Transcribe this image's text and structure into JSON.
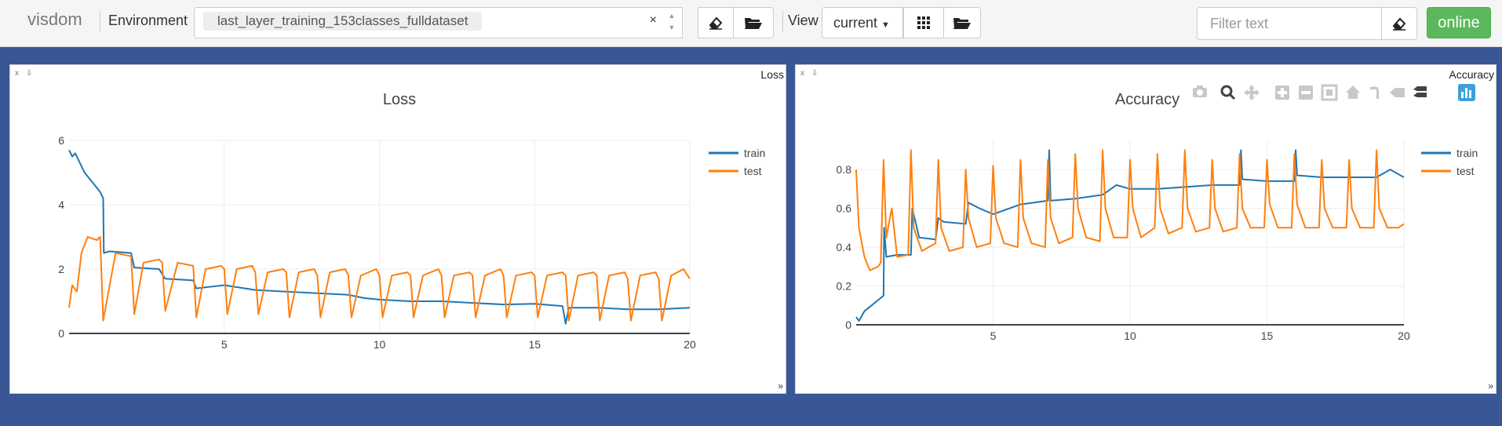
{
  "topbar": {
    "brand": "visdom",
    "environment_label": "Environment",
    "environment_value": "last_layer_training_153classes_fulldataset",
    "clear_symbol": "×",
    "view_label": "View",
    "view_select": "current",
    "filter_placeholder": "Filter text",
    "online_label": "online"
  },
  "panes": {
    "loss": {
      "window_title": "Loss",
      "close_label": "x",
      "download_label": "⇩",
      "resize_label": "»"
    },
    "accuracy": {
      "window_title": "Accuracy",
      "close_label": "x",
      "download_label": "⇩",
      "resize_label": "»"
    }
  },
  "icons": [
    "eraser-icon",
    "folder-open-icon",
    "grid-icon",
    "camera-icon",
    "zoom-icon",
    "pan-icon",
    "zoom-in-icon",
    "zoom-out-icon",
    "autoscale-icon",
    "home-icon",
    "spike-lines-icon",
    "hover-closest-icon",
    "hover-compare-icon",
    "plotly-logo-icon"
  ],
  "colors": {
    "train": "#1f77b4",
    "test": "#ff7f0e",
    "background": "#3a5795",
    "online": "#5cb85c"
  },
  "chart_data": [
    {
      "type": "line",
      "title": "Loss",
      "xlim": [
        0,
        20
      ],
      "ylim": [
        0,
        6
      ],
      "xticks": [
        5,
        10,
        15,
        20
      ],
      "yticks": [
        0,
        2,
        4,
        6
      ],
      "grid": true,
      "legend": "top-right",
      "series": [
        {
          "name": "train",
          "x": [
            0,
            0.1,
            0.2,
            0.5,
            1.0,
            1.1,
            1.12,
            1.3,
            2.0,
            2.1,
            2.9,
            3.1,
            4.0,
            4.1,
            5.0,
            6.0,
            7.0,
            8.0,
            9.0,
            9.5,
            10.0,
            11.0,
            12.0,
            13.0,
            14.0,
            15.0,
            15.9,
            16.0,
            16.1,
            17.0,
            18.0,
            19.0,
            20.0
          ],
          "values": [
            5.7,
            5.5,
            5.6,
            5.0,
            4.4,
            4.2,
            2.5,
            2.55,
            2.5,
            2.05,
            2.0,
            1.7,
            1.65,
            1.4,
            1.5,
            1.35,
            1.3,
            1.25,
            1.2,
            1.1,
            1.05,
            1.0,
            1.0,
            0.95,
            0.9,
            0.92,
            0.85,
            0.3,
            0.8,
            0.8,
            0.75,
            0.75,
            0.8
          ]
        },
        {
          "name": "test",
          "x": [
            0,
            0.1,
            0.25,
            0.4,
            0.6,
            0.9,
            1.0,
            1.1,
            1.5,
            2.0,
            2.1,
            2.4,
            2.9,
            3.0,
            3.1,
            3.5,
            4.0,
            4.1,
            4.4,
            4.9,
            5.0,
            5.1,
            5.4,
            5.9,
            6.0,
            6.1,
            6.4,
            6.9,
            7.0,
            7.1,
            7.4,
            7.9,
            8.0,
            8.1,
            8.4,
            8.9,
            9.0,
            9.1,
            9.4,
            9.9,
            10.0,
            10.1,
            10.4,
            10.9,
            11.0,
            11.1,
            11.4,
            11.9,
            12.0,
            12.1,
            12.4,
            12.9,
            13.0,
            13.1,
            13.4,
            13.9,
            14.0,
            14.1,
            14.4,
            14.9,
            15.0,
            15.1,
            15.4,
            15.9,
            16.0,
            16.1,
            16.4,
            16.9,
            17.0,
            17.1,
            17.4,
            17.9,
            18.0,
            18.1,
            18.4,
            18.9,
            19.0,
            19.1,
            19.4,
            19.8,
            20.0
          ],
          "values": [
            0.8,
            1.5,
            1.3,
            2.5,
            3.0,
            2.9,
            3.0,
            0.4,
            2.5,
            2.4,
            0.6,
            2.2,
            2.3,
            2.2,
            0.7,
            2.2,
            2.1,
            0.5,
            2.0,
            2.1,
            2.0,
            0.6,
            2.0,
            2.1,
            1.9,
            0.6,
            1.9,
            2.0,
            1.9,
            0.5,
            1.9,
            2.0,
            1.8,
            0.5,
            1.9,
            2.0,
            1.8,
            0.5,
            1.8,
            2.0,
            1.8,
            0.5,
            1.8,
            1.9,
            1.8,
            0.5,
            1.8,
            2.0,
            1.8,
            0.5,
            1.8,
            1.9,
            1.8,
            0.5,
            1.8,
            2.0,
            1.8,
            0.5,
            1.8,
            1.9,
            1.8,
            0.5,
            1.8,
            1.9,
            1.8,
            0.4,
            1.8,
            1.9,
            1.8,
            0.4,
            1.8,
            1.9,
            1.7,
            0.4,
            1.8,
            1.9,
            1.7,
            0.4,
            1.8,
            2.0,
            1.7
          ]
        }
      ]
    },
    {
      "type": "line",
      "title": "Accuracy",
      "xlim": [
        0,
        20
      ],
      "ylim": [
        0,
        0.95
      ],
      "xticks": [
        5,
        10,
        15,
        20
      ],
      "yticks": [
        0,
        0.2,
        0.4,
        0.6,
        0.8
      ],
      "grid": true,
      "legend": "top-right",
      "series": [
        {
          "name": "train",
          "x": [
            0,
            0.1,
            0.3,
            1.0,
            1.02,
            1.1,
            1.5,
            2.0,
            2.05,
            2.3,
            2.9,
            3.0,
            3.2,
            4.0,
            4.1,
            4.5,
            5.0,
            6.0,
            7.0,
            7.05,
            7.1,
            8.0,
            9.0,
            9.5,
            10.0,
            11.0,
            12.0,
            13.0,
            14.0,
            14.05,
            14.1,
            15.0,
            16.0,
            16.05,
            16.1,
            17.0,
            18.0,
            19.0,
            19.5,
            20.0
          ],
          "values": [
            0.04,
            0.02,
            0.07,
            0.15,
            0.5,
            0.35,
            0.36,
            0.36,
            0.6,
            0.45,
            0.44,
            0.55,
            0.53,
            0.52,
            0.63,
            0.6,
            0.57,
            0.62,
            0.64,
            0.9,
            0.64,
            0.65,
            0.67,
            0.72,
            0.7,
            0.7,
            0.71,
            0.72,
            0.72,
            0.9,
            0.75,
            0.74,
            0.74,
            0.9,
            0.77,
            0.76,
            0.76,
            0.76,
            0.8,
            0.76
          ]
        },
        {
          "name": "test",
          "x": [
            0,
            0.1,
            0.3,
            0.5,
            0.8,
            0.9,
            1.0,
            1.1,
            1.3,
            1.5,
            1.9,
            2.0,
            2.1,
            2.4,
            2.9,
            3.0,
            3.1,
            3.4,
            3.9,
            4.0,
            4.1,
            4.4,
            4.9,
            5.0,
            5.1,
            5.4,
            5.9,
            6.0,
            6.1,
            6.4,
            6.9,
            7.0,
            7.1,
            7.4,
            7.9,
            8.0,
            8.1,
            8.4,
            8.9,
            9.0,
            9.1,
            9.4,
            9.9,
            10.0,
            10.1,
            10.4,
            10.9,
            11.0,
            11.1,
            11.4,
            11.9,
            12.0,
            12.1,
            12.4,
            12.9,
            13.0,
            13.1,
            13.4,
            13.9,
            14.0,
            14.1,
            14.4,
            14.9,
            15.0,
            15.1,
            15.4,
            15.9,
            16.0,
            16.1,
            16.4,
            16.9,
            17.0,
            17.1,
            17.4,
            17.9,
            18.0,
            18.1,
            18.4,
            18.9,
            19.0,
            19.1,
            19.4,
            19.8,
            20.0
          ],
          "values": [
            0.8,
            0.5,
            0.35,
            0.28,
            0.3,
            0.32,
            0.85,
            0.45,
            0.6,
            0.35,
            0.36,
            0.9,
            0.5,
            0.38,
            0.42,
            0.85,
            0.5,
            0.38,
            0.4,
            0.8,
            0.55,
            0.4,
            0.42,
            0.82,
            0.55,
            0.42,
            0.4,
            0.85,
            0.55,
            0.42,
            0.4,
            0.85,
            0.55,
            0.42,
            0.45,
            0.88,
            0.6,
            0.45,
            0.43,
            0.9,
            0.6,
            0.45,
            0.45,
            0.85,
            0.6,
            0.45,
            0.5,
            0.88,
            0.6,
            0.47,
            0.5,
            0.9,
            0.6,
            0.48,
            0.5,
            0.85,
            0.6,
            0.48,
            0.5,
            0.88,
            0.6,
            0.5,
            0.5,
            0.85,
            0.62,
            0.5,
            0.5,
            0.88,
            0.62,
            0.5,
            0.5,
            0.85,
            0.6,
            0.5,
            0.5,
            0.85,
            0.6,
            0.5,
            0.5,
            0.9,
            0.6,
            0.5,
            0.5,
            0.52
          ]
        }
      ]
    }
  ]
}
